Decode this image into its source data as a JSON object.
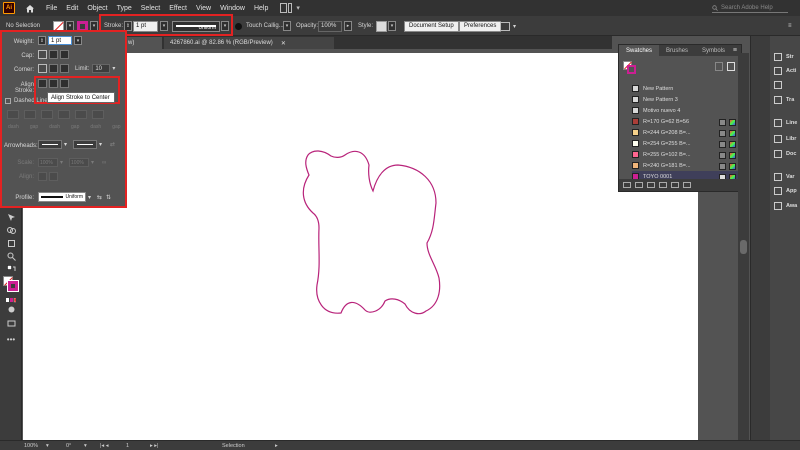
{
  "app": {
    "logo": "Ai",
    "search_placeholder": "Search Adobe Help"
  },
  "menu": [
    "File",
    "Edit",
    "Object",
    "Type",
    "Select",
    "Effect",
    "View",
    "Window",
    "Help"
  ],
  "control_bar": {
    "selection": "No Selection",
    "stroke_label": "Stroke:",
    "stroke_value": "1 pt",
    "profile": "Uniform",
    "brush": "Touch Callig...",
    "opacity_label": "Opacity:",
    "opacity_value": "100%",
    "style_label": "Style:",
    "document_setup": "Document Setup",
    "preferences": "Preferences"
  },
  "tabs": [
    {
      "label": "w)",
      "active": true
    },
    {
      "label": "4267860.ai @ 82.86 % (RGB/Preview)",
      "active": false
    }
  ],
  "stroke_panel": {
    "weight_label": "Weight:",
    "weight_value": "1 pt",
    "cap_label": "Cap:",
    "corner_label": "Corner:",
    "limit_label": "Limit:",
    "limit_value": "10",
    "align_label": "Align Stroke:",
    "dashed_label": "Dashed Line",
    "dash_labels": [
      "dash",
      "gap",
      "dash",
      "gap",
      "dash",
      "gap"
    ],
    "arrowheads_label": "Arrowheads:",
    "scale_label": "Scale:",
    "scale_value_1": "100%",
    "scale_value_2": "100%",
    "align_label2": "Align:",
    "profile_label": "Profile:",
    "profile_value": "Uniform"
  },
  "tooltip": "Align Stroke to Center",
  "swatches": {
    "tabs": [
      "Swatches",
      "Brushes",
      "Symbols"
    ],
    "items": [
      {
        "name": "New Pattern",
        "color": "#d8d8d8"
      },
      {
        "name": "New Pattern 3",
        "color": "#d8d8d8"
      },
      {
        "name": "Motivo nuevo 4",
        "color": "#d8d8d8"
      },
      {
        "name": "R=170 G=62 B=56",
        "color": "#aa3e38"
      },
      {
        "name": "R=244 G=208 B=...",
        "color": "#f4d08a"
      },
      {
        "name": "R=254 G=255 B=...",
        "color": "#fefff0"
      },
      {
        "name": "R=255 G=102 B=...",
        "color": "#ff6690"
      },
      {
        "name": "R=240 G=181 B=...",
        "color": "#f0b57a"
      },
      {
        "name": "TOYO 0001",
        "color": "#cc1f93"
      }
    ]
  },
  "dock": [
    "Str",
    "Acti",
    "",
    "Tra",
    "Line",
    "Libr",
    "Doc",
    "Var",
    "App",
    "Awa"
  ],
  "status": {
    "zoom": "100%",
    "angle": "0°",
    "page": "1",
    "mode": "Selection"
  },
  "colors": {
    "accent": "#cc1f93",
    "highlight": "#e32222"
  }
}
